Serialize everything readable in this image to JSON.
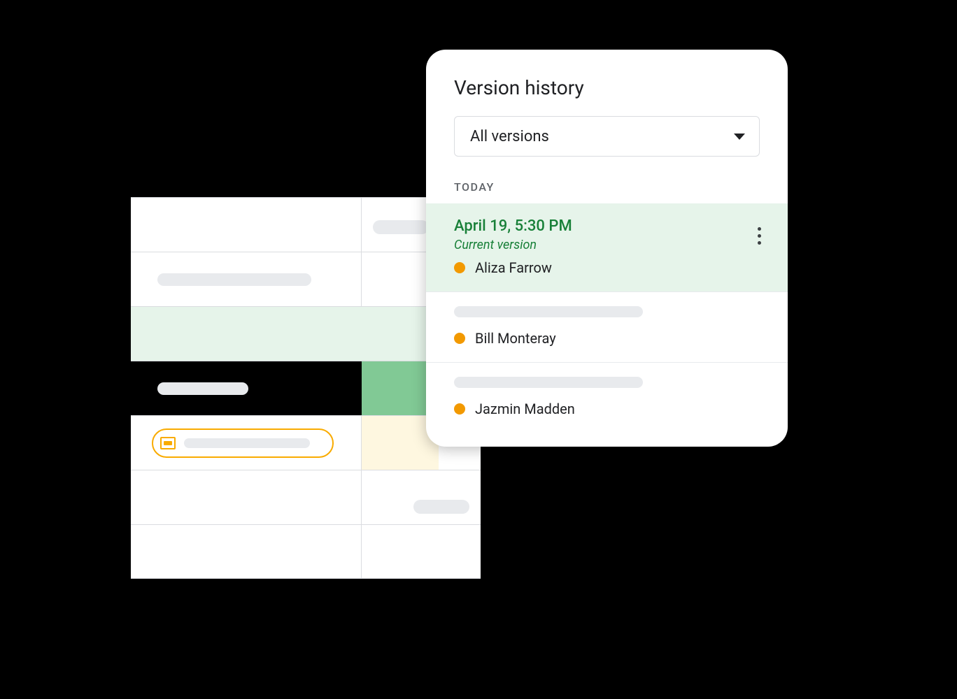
{
  "panel": {
    "title": "Version history",
    "dropdown_label": "All versions",
    "section_label": "TODAY",
    "versions": [
      {
        "timestamp": "April 19, 5:30 PM",
        "subtitle": "Current version",
        "editor": "Aliza Farrow",
        "dot_color": "#f29900",
        "selected": true
      },
      {
        "editor": "Bill Monteray",
        "dot_color": "#f29900"
      },
      {
        "editor": "Jazmin Madden",
        "dot_color": "#f29900"
      }
    ]
  }
}
